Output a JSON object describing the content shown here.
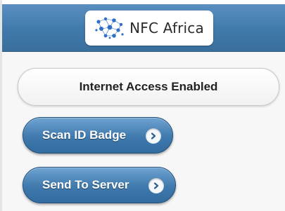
{
  "header": {
    "logo_text": "NFC Africa"
  },
  "status": {
    "label": "Internet Access Enabled"
  },
  "actions": [
    {
      "label": "Scan ID Badge",
      "icon": "chevron-right-icon"
    },
    {
      "label": "Send To Server",
      "icon": "chevron-right-icon"
    }
  ],
  "colors": {
    "header": "#3f7aab",
    "button": "#3f79ad",
    "logo_dots": "#2f6fc6"
  }
}
